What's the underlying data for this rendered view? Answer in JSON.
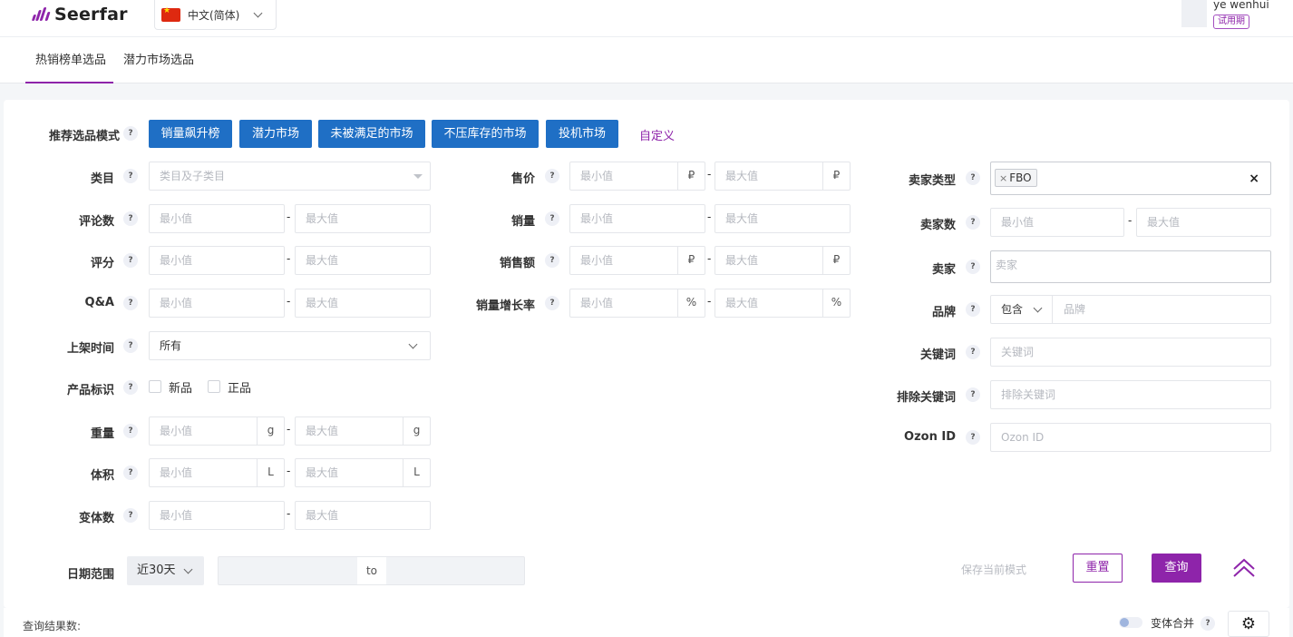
{
  "app": {
    "logo_text": "Seerfar",
    "brand_color": "#8e24aa"
  },
  "language": {
    "label": "中文(简体)",
    "flag": "cn-flag-icon"
  },
  "user": {
    "name": "ye wenhui",
    "badge": "试用期"
  },
  "tabs": [
    {
      "label": "热销榜单选品",
      "active": true
    },
    {
      "label": "潜力市场选品",
      "active": false
    }
  ],
  "mode": {
    "label": "推荐选品模式",
    "buttons": [
      "销量飙升榜",
      "潜力市场",
      "未被满足的市场",
      "不压库存的市场",
      "投机市场"
    ],
    "custom": "自定义",
    "button_color": "#1f6fc5"
  },
  "filters": {
    "category": {
      "label": "类目",
      "placeholder": "类目及子类目"
    },
    "reviews": {
      "label": "评论数",
      "min": "最小值",
      "max": "最大值"
    },
    "rating": {
      "label": "评分",
      "min": "最小值",
      "max": "最大值"
    },
    "qa": {
      "label": "Q&A",
      "min": "最小值",
      "max": "最大值"
    },
    "listing_time": {
      "label": "上架时间",
      "value": "所有"
    },
    "product_tag": {
      "label": "产品标识",
      "options": [
        "新品",
        "正品"
      ]
    },
    "weight": {
      "label": "重量",
      "min": "最小值",
      "max": "最大值",
      "unit": "g"
    },
    "volume": {
      "label": "体积",
      "min": "最小值",
      "max": "最大值",
      "unit": "L"
    },
    "variants": {
      "label": "变体数",
      "min": "最小值",
      "max": "最大值"
    },
    "price": {
      "label": "售价",
      "min": "最小值",
      "max": "最大值",
      "unit": "₽"
    },
    "sales": {
      "label": "销量",
      "min": "最小值",
      "max": "最大值"
    },
    "revenue": {
      "label": "销售额",
      "min": "最小值",
      "max": "最大值",
      "unit": "₽"
    },
    "growth": {
      "label": "销量增长率",
      "min": "最小值",
      "max": "最大值",
      "unit": "%"
    },
    "seller_type": {
      "label": "卖家类型",
      "tag": "FBO"
    },
    "seller_count": {
      "label": "卖家数",
      "min": "最小值",
      "max": "最大值"
    },
    "seller": {
      "label": "卖家",
      "placeholder": "卖家"
    },
    "brand": {
      "label": "品牌",
      "mode": "包含",
      "placeholder": "品牌"
    },
    "keyword": {
      "label": "关键词",
      "placeholder": "关键词"
    },
    "exclude_keyword": {
      "label": "排除关键词",
      "placeholder": "排除关键词"
    },
    "ozon_id": {
      "label": "Ozon ID",
      "placeholder": "Ozon ID"
    },
    "dash": "-"
  },
  "date": {
    "label": "日期范围",
    "preset": "近30天",
    "sep": "to"
  },
  "actions": {
    "save": "保存当前模式",
    "reset": "重置",
    "query": "查询"
  },
  "footer": {
    "result_label": "查询结果数:",
    "merge_label": "变体合并"
  }
}
